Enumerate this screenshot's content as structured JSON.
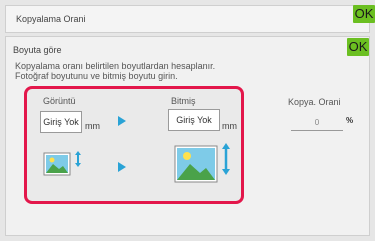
{
  "header": {
    "title": "Kopyalama Orani",
    "ok_label": "OK"
  },
  "panel": {
    "title": "Boyuta göre",
    "ok_label": "OK",
    "description_lines": [
      "Kopyalama oranı belirtilen boyutlardan hesaplanır.",
      "Fotoğraf boyutunu ve bitmiş boyutu girin."
    ]
  },
  "original": {
    "label": "Görüntü",
    "input_value": "Giriş Yok",
    "unit": "mm"
  },
  "finished": {
    "label": "Bitmiş",
    "input_value": "Giriş Yok",
    "unit": "mm"
  },
  "ratio": {
    "label": "Kopya. Orani",
    "value": "0",
    "unit": "%"
  },
  "icons": {
    "arrows": "play-arrow-icon",
    "small_image": "photo-image-small-icon",
    "large_image": "photo-image-large-icon"
  },
  "colors": {
    "ok": "#6bbf21",
    "highlight": "#e3174b",
    "arrow": "#2aa3d6"
  }
}
